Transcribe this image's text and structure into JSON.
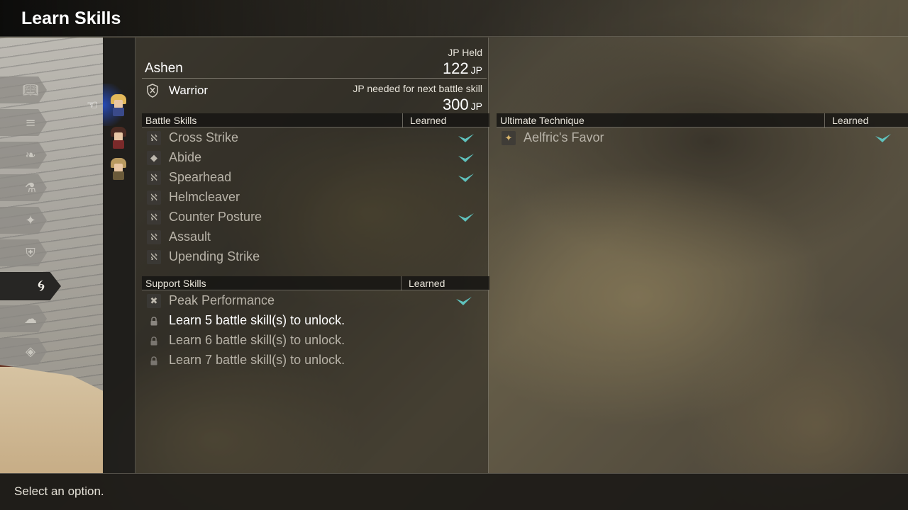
{
  "header": {
    "title": "Learn Skills"
  },
  "character": {
    "name": "Ashen",
    "job": "Warrior",
    "jp_held_label": "JP Held",
    "jp_held_value": "122",
    "jp_unit": "JP",
    "jp_next_label": "JP needed for next battle skill",
    "jp_next_value": "300"
  },
  "category_tabs": [
    {
      "icon": "book-icon",
      "active": false
    },
    {
      "icon": "scroll-icon",
      "active": false
    },
    {
      "icon": "feather-icon",
      "active": false
    },
    {
      "icon": "potion-icon",
      "active": false
    },
    {
      "icon": "sparkle-icon",
      "active": false
    },
    {
      "icon": "shield-icon",
      "active": false
    },
    {
      "icon": "swirl-icon",
      "active": true
    },
    {
      "icon": "chat-icon",
      "active": false
    },
    {
      "icon": "tag-icon",
      "active": false
    }
  ],
  "portraits": [
    {
      "name": "blonde-hero-portrait",
      "selected": true
    },
    {
      "name": "dark-haired-portrait",
      "selected": false
    },
    {
      "name": "sandy-haired-portrait",
      "selected": false
    }
  ],
  "battle_skills": {
    "header": "Battle Skills",
    "learned_header": "Learned",
    "items": [
      {
        "name": "Cross Strike",
        "learned": true
      },
      {
        "name": "Abide",
        "learned": true
      },
      {
        "name": "Spearhead",
        "learned": true
      },
      {
        "name": "Helmcleaver",
        "learned": false
      },
      {
        "name": "Counter Posture",
        "learned": true
      },
      {
        "name": "Assault",
        "learned": false
      },
      {
        "name": "Upending Strike",
        "learned": false
      }
    ]
  },
  "support_skills": {
    "header": "Support Skills",
    "learned_header": "Learned",
    "items": [
      {
        "name": "Peak Performance",
        "learned": true,
        "locked": false
      },
      {
        "name": "Learn 5 battle skill(s) to unlock.",
        "learned": false,
        "locked": true
      },
      {
        "name": "Learn 6 battle skill(s) to unlock.",
        "learned": false,
        "locked": true
      },
      {
        "name": "Learn 7 battle skill(s) to unlock.",
        "learned": false,
        "locked": true
      }
    ]
  },
  "ultimate": {
    "header": "Ultimate Technique",
    "learned_header": "Learned",
    "items": [
      {
        "name": "Aelfric's Favor",
        "learned": true
      }
    ]
  },
  "footer": {
    "text": "Select an option."
  },
  "colors": {
    "check": "#5fc2bd",
    "accent_blue": "#2850c8"
  }
}
